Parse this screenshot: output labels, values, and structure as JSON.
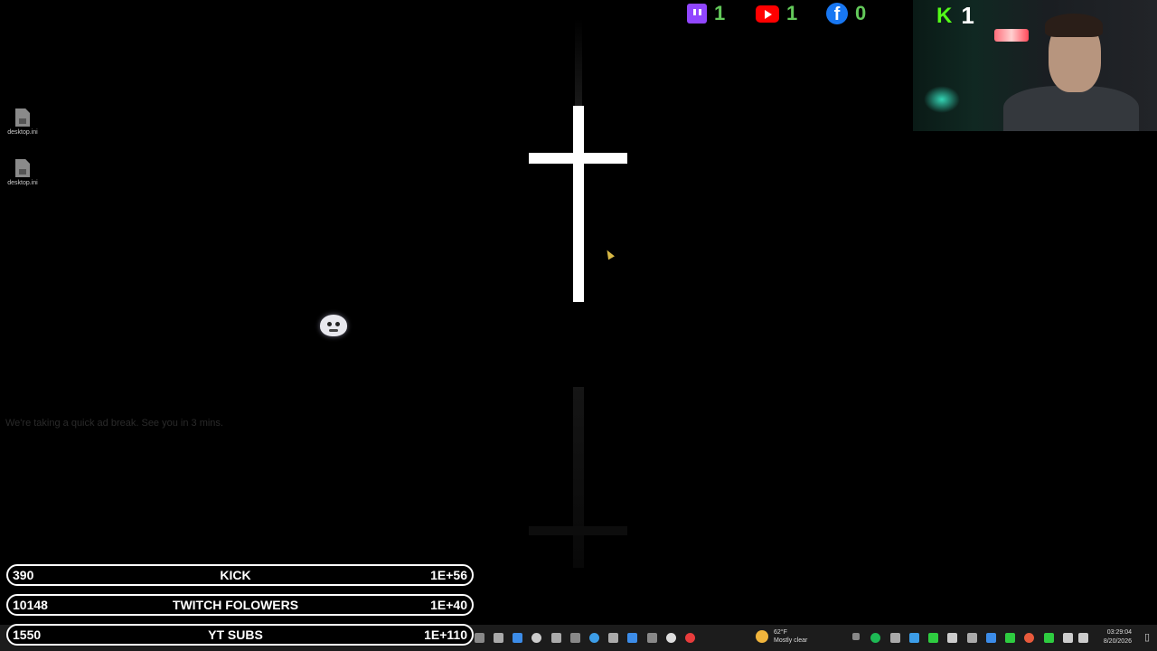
{
  "desktop": {
    "icons": [
      {
        "label": "desktop.ini"
      },
      {
        "label": "desktop.ini"
      }
    ]
  },
  "chat": {
    "username": "",
    "message": "We're taking a quick ad break. See you in 3 mins."
  },
  "social": {
    "twitch": {
      "count": "1"
    },
    "youtube": {
      "count": "1"
    },
    "facebook": {
      "count": "0",
      "glyph": "f"
    },
    "kick": {
      "count": "1",
      "glyph": "K"
    }
  },
  "goals": [
    {
      "current": "390",
      "name": "KICK",
      "target": "1E+56"
    },
    {
      "current": "10148",
      "name": "TWITCH FOLOWERS",
      "target": "1E+40"
    },
    {
      "current": "1550",
      "name": "YT SUBS",
      "target": "1E+110"
    }
  ],
  "taskbar": {
    "weather_temp": "62°F",
    "weather_desc": "Mostly clear",
    "time": "03:29:04",
    "date": "8/20/2026"
  },
  "colors": {
    "twitch": "#9146ff",
    "youtube": "#ff0000",
    "facebook": "#1877f2",
    "kick": "#53fc18",
    "counter": "#63c95a"
  }
}
